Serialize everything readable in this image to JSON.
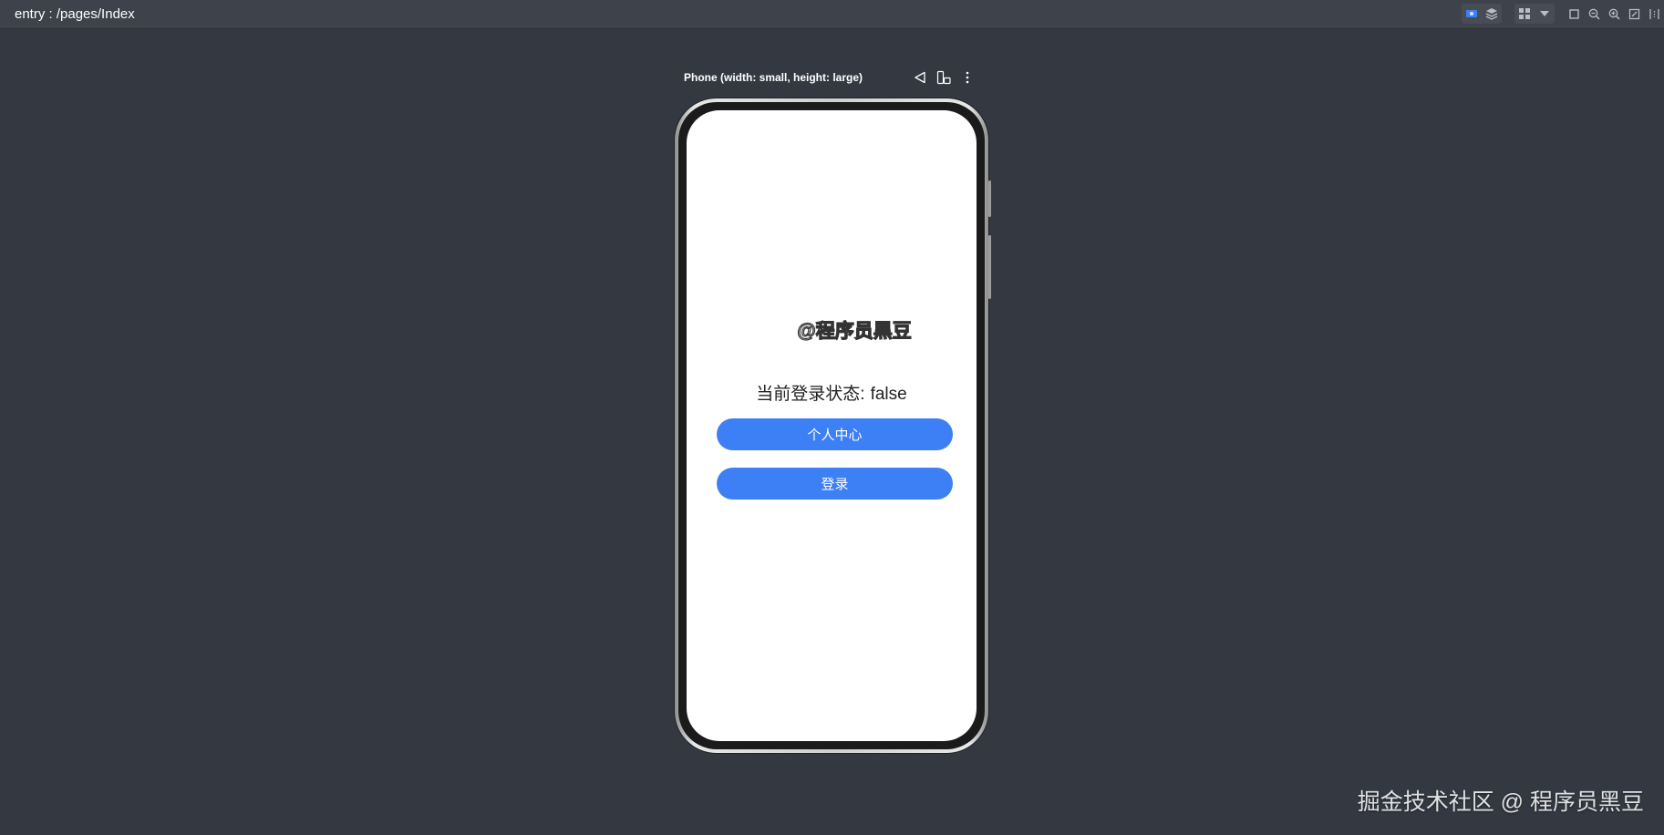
{
  "window": {
    "title": "entry : /pages/Index"
  },
  "toolbar": {
    "icons": [
      "inspector-icon",
      "layers-icon",
      "grid-icon",
      "dropdown-icon",
      "crop-icon",
      "zoom-out-icon",
      "zoom-in-icon",
      "fit-screen-icon",
      "split-icon"
    ]
  },
  "device": {
    "label": "Phone (width: small, height: large)",
    "tools": [
      "back-triangle-icon",
      "rotate-device-icon",
      "more-vert-icon"
    ]
  },
  "app": {
    "watermark": "@程序员黑豆",
    "status_label": "当前登录状态:",
    "status_value": "false",
    "profile_button": "个人中心",
    "login_button": "登录"
  },
  "footer": {
    "site_watermark": "掘金技术社区 @ 程序员黑豆"
  },
  "colors": {
    "background": "#343941",
    "accent_button": "#3d7ff5",
    "screen": "#ffffff"
  }
}
